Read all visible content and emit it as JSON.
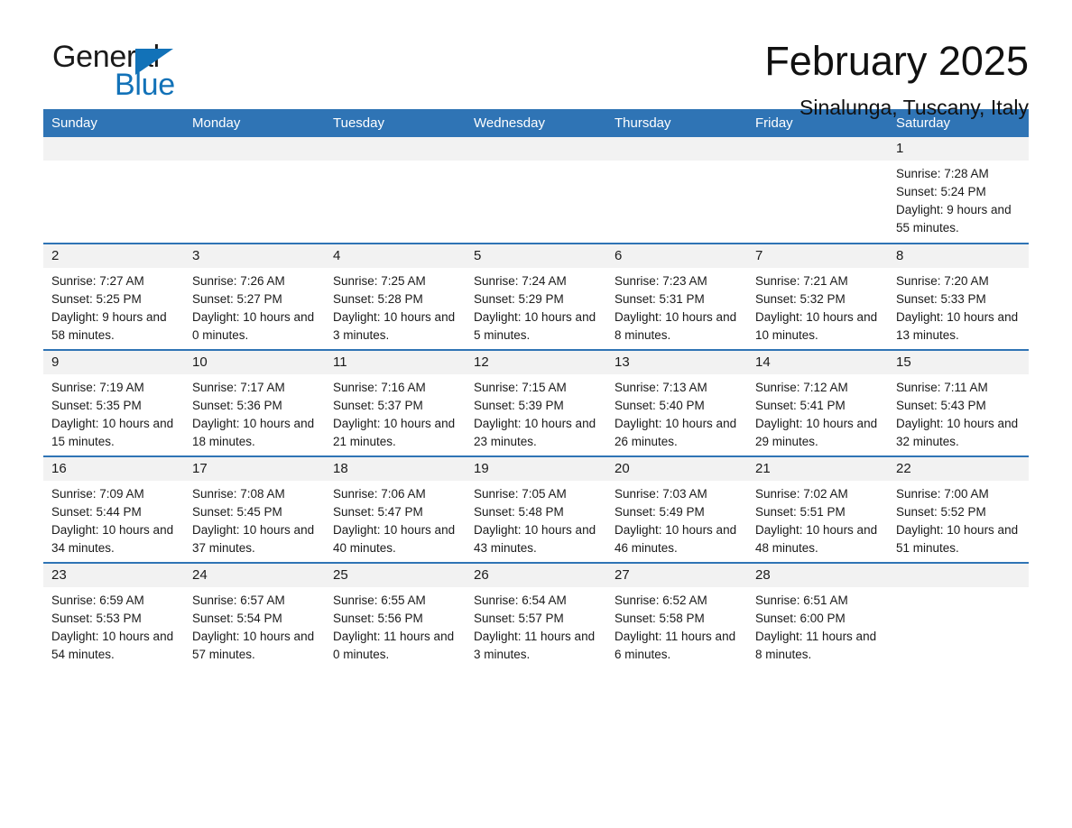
{
  "brand": {
    "word1": "General",
    "word2": "Blue",
    "triangle_icon": "brand-triangle-icon",
    "accent_color": "#1272b8"
  },
  "header": {
    "title": "February 2025",
    "subtitle": "Sinalunga, Tuscany, Italy"
  },
  "calendar": {
    "header_bg": "#2f74b5",
    "daynum_bg": "#f2f2f2",
    "weekday_headers": [
      "Sunday",
      "Monday",
      "Tuesday",
      "Wednesday",
      "Thursday",
      "Friday",
      "Saturday"
    ],
    "weeks": [
      [
        {
          "day": "",
          "blank": true
        },
        {
          "day": "",
          "blank": true
        },
        {
          "day": "",
          "blank": true
        },
        {
          "day": "",
          "blank": true
        },
        {
          "day": "",
          "blank": true
        },
        {
          "day": "",
          "blank": true
        },
        {
          "day": "1",
          "sunrise": "Sunrise: 7:28 AM",
          "sunset": "Sunset: 5:24 PM",
          "daylight": "Daylight: 9 hours and 55 minutes."
        }
      ],
      [
        {
          "day": "2",
          "sunrise": "Sunrise: 7:27 AM",
          "sunset": "Sunset: 5:25 PM",
          "daylight": "Daylight: 9 hours and 58 minutes."
        },
        {
          "day": "3",
          "sunrise": "Sunrise: 7:26 AM",
          "sunset": "Sunset: 5:27 PM",
          "daylight": "Daylight: 10 hours and 0 minutes."
        },
        {
          "day": "4",
          "sunrise": "Sunrise: 7:25 AM",
          "sunset": "Sunset: 5:28 PM",
          "daylight": "Daylight: 10 hours and 3 minutes."
        },
        {
          "day": "5",
          "sunrise": "Sunrise: 7:24 AM",
          "sunset": "Sunset: 5:29 PM",
          "daylight": "Daylight: 10 hours and 5 minutes."
        },
        {
          "day": "6",
          "sunrise": "Sunrise: 7:23 AM",
          "sunset": "Sunset: 5:31 PM",
          "daylight": "Daylight: 10 hours and 8 minutes."
        },
        {
          "day": "7",
          "sunrise": "Sunrise: 7:21 AM",
          "sunset": "Sunset: 5:32 PM",
          "daylight": "Daylight: 10 hours and 10 minutes."
        },
        {
          "day": "8",
          "sunrise": "Sunrise: 7:20 AM",
          "sunset": "Sunset: 5:33 PM",
          "daylight": "Daylight: 10 hours and 13 minutes."
        }
      ],
      [
        {
          "day": "9",
          "sunrise": "Sunrise: 7:19 AM",
          "sunset": "Sunset: 5:35 PM",
          "daylight": "Daylight: 10 hours and 15 minutes."
        },
        {
          "day": "10",
          "sunrise": "Sunrise: 7:17 AM",
          "sunset": "Sunset: 5:36 PM",
          "daylight": "Daylight: 10 hours and 18 minutes."
        },
        {
          "day": "11",
          "sunrise": "Sunrise: 7:16 AM",
          "sunset": "Sunset: 5:37 PM",
          "daylight": "Daylight: 10 hours and 21 minutes."
        },
        {
          "day": "12",
          "sunrise": "Sunrise: 7:15 AM",
          "sunset": "Sunset: 5:39 PM",
          "daylight": "Daylight: 10 hours and 23 minutes."
        },
        {
          "day": "13",
          "sunrise": "Sunrise: 7:13 AM",
          "sunset": "Sunset: 5:40 PM",
          "daylight": "Daylight: 10 hours and 26 minutes."
        },
        {
          "day": "14",
          "sunrise": "Sunrise: 7:12 AM",
          "sunset": "Sunset: 5:41 PM",
          "daylight": "Daylight: 10 hours and 29 minutes."
        },
        {
          "day": "15",
          "sunrise": "Sunrise: 7:11 AM",
          "sunset": "Sunset: 5:43 PM",
          "daylight": "Daylight: 10 hours and 32 minutes."
        }
      ],
      [
        {
          "day": "16",
          "sunrise": "Sunrise: 7:09 AM",
          "sunset": "Sunset: 5:44 PM",
          "daylight": "Daylight: 10 hours and 34 minutes."
        },
        {
          "day": "17",
          "sunrise": "Sunrise: 7:08 AM",
          "sunset": "Sunset: 5:45 PM",
          "daylight": "Daylight: 10 hours and 37 minutes."
        },
        {
          "day": "18",
          "sunrise": "Sunrise: 7:06 AM",
          "sunset": "Sunset: 5:47 PM",
          "daylight": "Daylight: 10 hours and 40 minutes."
        },
        {
          "day": "19",
          "sunrise": "Sunrise: 7:05 AM",
          "sunset": "Sunset: 5:48 PM",
          "daylight": "Daylight: 10 hours and 43 minutes."
        },
        {
          "day": "20",
          "sunrise": "Sunrise: 7:03 AM",
          "sunset": "Sunset: 5:49 PM",
          "daylight": "Daylight: 10 hours and 46 minutes."
        },
        {
          "day": "21",
          "sunrise": "Sunrise: 7:02 AM",
          "sunset": "Sunset: 5:51 PM",
          "daylight": "Daylight: 10 hours and 48 minutes."
        },
        {
          "day": "22",
          "sunrise": "Sunrise: 7:00 AM",
          "sunset": "Sunset: 5:52 PM",
          "daylight": "Daylight: 10 hours and 51 minutes."
        }
      ],
      [
        {
          "day": "23",
          "sunrise": "Sunrise: 6:59 AM",
          "sunset": "Sunset: 5:53 PM",
          "daylight": "Daylight: 10 hours and 54 minutes."
        },
        {
          "day": "24",
          "sunrise": "Sunrise: 6:57 AM",
          "sunset": "Sunset: 5:54 PM",
          "daylight": "Daylight: 10 hours and 57 minutes."
        },
        {
          "day": "25",
          "sunrise": "Sunrise: 6:55 AM",
          "sunset": "Sunset: 5:56 PM",
          "daylight": "Daylight: 11 hours and 0 minutes."
        },
        {
          "day": "26",
          "sunrise": "Sunrise: 6:54 AM",
          "sunset": "Sunset: 5:57 PM",
          "daylight": "Daylight: 11 hours and 3 minutes."
        },
        {
          "day": "27",
          "sunrise": "Sunrise: 6:52 AM",
          "sunset": "Sunset: 5:58 PM",
          "daylight": "Daylight: 11 hours and 6 minutes."
        },
        {
          "day": "28",
          "sunrise": "Sunrise: 6:51 AM",
          "sunset": "Sunset: 6:00 PM",
          "daylight": "Daylight: 11 hours and 8 minutes."
        },
        {
          "day": "",
          "blank": true,
          "plain": true
        }
      ]
    ]
  }
}
